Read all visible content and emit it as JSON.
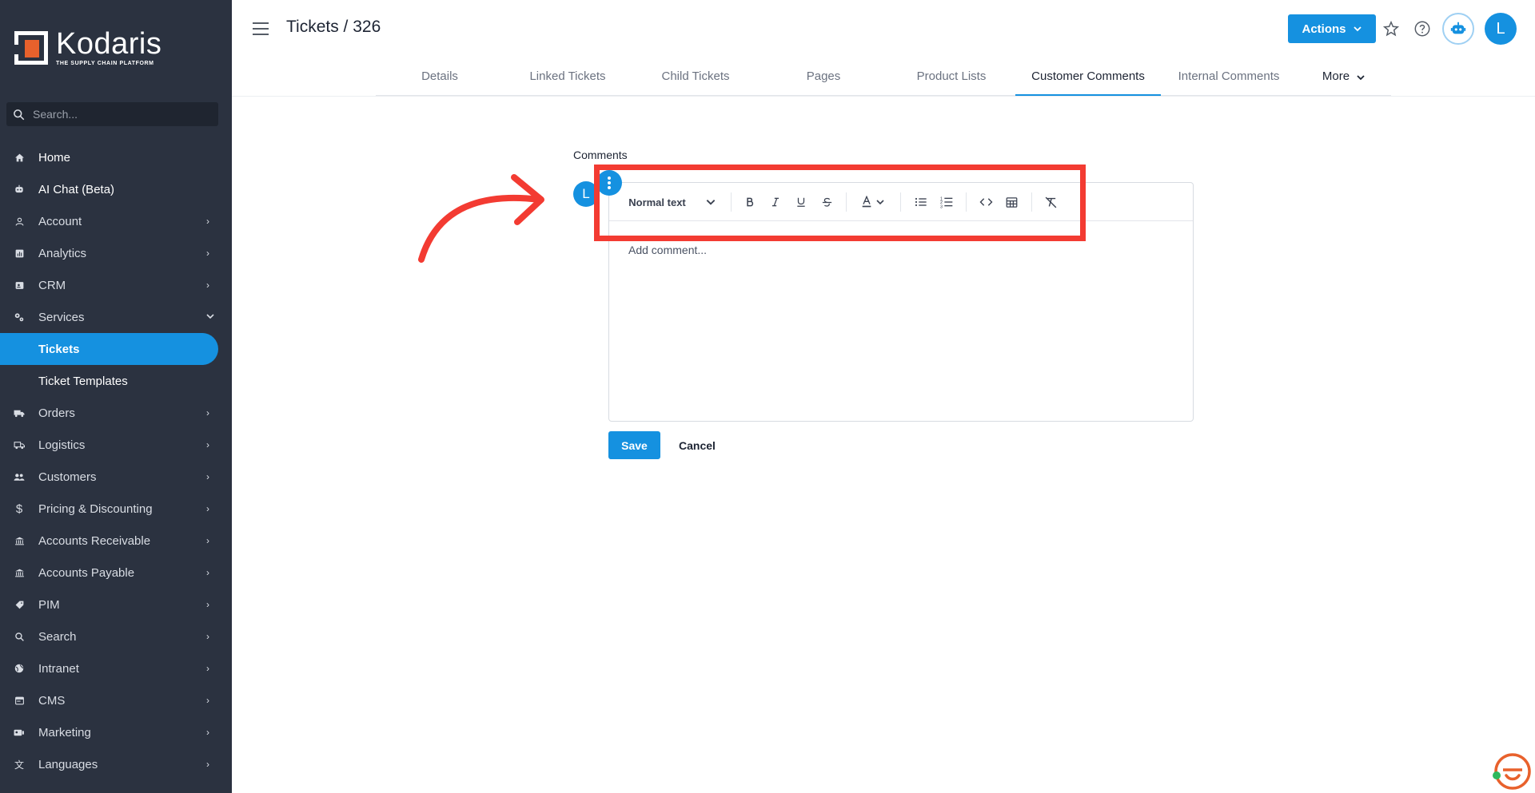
{
  "brand": {
    "name": "Kodaris",
    "tagline": "THE SUPPLY CHAIN PLATFORM",
    "accent": "#1591e0",
    "logo_orange": "#e8612c",
    "sidebar_bg": "#2b3240",
    "highlight": "#f33b32"
  },
  "search": {
    "placeholder": "Search..."
  },
  "sidebar": {
    "items": [
      {
        "label": "Home",
        "icon": "home-icon",
        "chevron": false
      },
      {
        "label": "AI Chat (Beta)",
        "icon": "robot-icon",
        "chevron": false
      },
      {
        "label": "Account",
        "icon": "person-icon",
        "chevron": true
      },
      {
        "label": "Analytics",
        "icon": "analytics-icon",
        "chevron": true
      },
      {
        "label": "CRM",
        "icon": "crm-icon",
        "chevron": true
      },
      {
        "label": "Services",
        "icon": "services-icon",
        "chevron": true,
        "expanded": true
      },
      {
        "label": "Tickets",
        "active": true
      },
      {
        "label": "Ticket Templates"
      },
      {
        "label": "Orders",
        "icon": "truck-icon",
        "chevron": true
      },
      {
        "label": "Logistics",
        "icon": "logistics-icon",
        "chevron": true
      },
      {
        "label": "Customers",
        "icon": "people-icon",
        "chevron": true
      },
      {
        "label": "Pricing & Discounting",
        "icon": "dollar-icon",
        "chevron": true
      },
      {
        "label": "Accounts Receivable",
        "icon": "bank-icon",
        "chevron": true
      },
      {
        "label": "Accounts Payable",
        "icon": "bank-icon",
        "chevron": true
      },
      {
        "label": "PIM",
        "icon": "tag-icon",
        "chevron": true
      },
      {
        "label": "Search",
        "icon": "search-icon",
        "chevron": true
      },
      {
        "label": "Intranet",
        "icon": "globe-icon",
        "chevron": true
      },
      {
        "label": "CMS",
        "icon": "cms-icon",
        "chevron": true
      },
      {
        "label": "Marketing",
        "icon": "marketing-icon",
        "chevron": true
      },
      {
        "label": "Languages",
        "icon": "translate-icon",
        "chevron": true
      }
    ]
  },
  "header": {
    "title": "Tickets / 326",
    "actions_label": "Actions",
    "user_initial": "L"
  },
  "tabs": [
    {
      "label": "Details"
    },
    {
      "label": "Linked Tickets"
    },
    {
      "label": "Child Tickets"
    },
    {
      "label": "Pages"
    },
    {
      "label": "Product Lists"
    },
    {
      "label": "Customer Comments",
      "active": true
    },
    {
      "label": "Internal Comments"
    },
    {
      "label": "More"
    }
  ],
  "comments": {
    "label": "Comments",
    "user_initial": "L",
    "text_style": "Normal text",
    "placeholder": "Add comment...",
    "save_label": "Save",
    "cancel_label": "Cancel"
  }
}
